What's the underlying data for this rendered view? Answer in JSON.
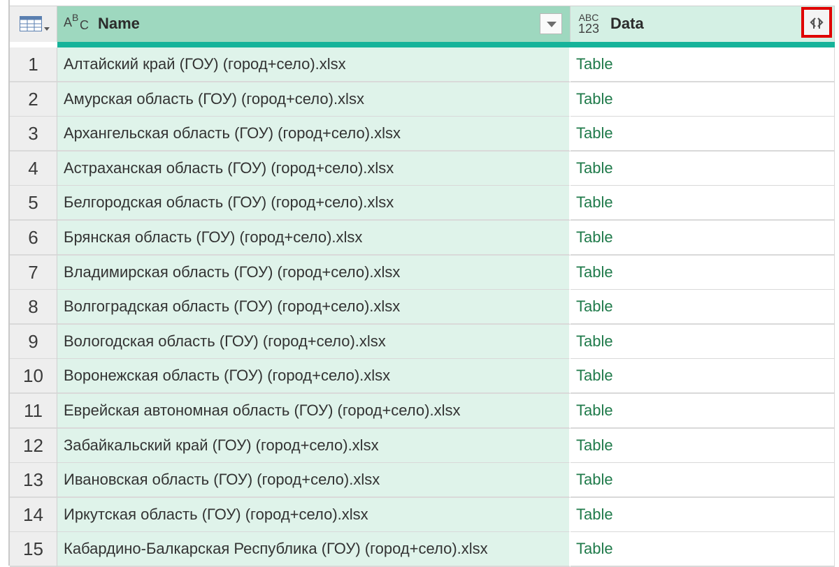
{
  "header": {
    "name_type_icon": "text-type-icon",
    "name_type_letters": [
      "A",
      "B",
      "C"
    ],
    "name_label": "Name",
    "data_type_icon": "any-type-icon",
    "data_type_top": "ABC",
    "data_type_bottom": "123",
    "data_label": "Data",
    "expand_icon": "expand-column-icon",
    "table_menu_icon": "table-icon"
  },
  "colors": {
    "header_name_bg": "#9ed8bf",
    "header_data_bg": "#d4f0e4",
    "accent_underline": "#16b39a",
    "name_cell_bg": "#dff3ea",
    "table_link": "#1f7a4a",
    "highlight_border": "#e00000"
  },
  "rows": [
    {
      "num": "1",
      "name": "Алтайский край (ГОУ) (город+село).xlsx",
      "data": "Table"
    },
    {
      "num": "2",
      "name": "Амурская область (ГОУ) (город+село).xlsx",
      "data": "Table"
    },
    {
      "num": "3",
      "name": "Архангельская область (ГОУ) (город+село).xlsx",
      "data": "Table"
    },
    {
      "num": "4",
      "name": "Астраханская область (ГОУ) (город+село).xlsx",
      "data": "Table"
    },
    {
      "num": "5",
      "name": "Белгородская область (ГОУ) (город+село).xlsx",
      "data": "Table"
    },
    {
      "num": "6",
      "name": "Брянская область (ГОУ) (город+село).xlsx",
      "data": "Table"
    },
    {
      "num": "7",
      "name": "Владимирская область (ГОУ) (город+село).xlsx",
      "data": "Table"
    },
    {
      "num": "8",
      "name": "Волгоградская область (ГОУ) (город+село).xlsx",
      "data": "Table"
    },
    {
      "num": "9",
      "name": "Вологодская область (ГОУ) (город+село).xlsx",
      "data": "Table"
    },
    {
      "num": "10",
      "name": "Воронежская область (ГОУ) (город+село).xlsx",
      "data": "Table"
    },
    {
      "num": "11",
      "name": "Еврейская автономная область (ГОУ) (город+село).xlsx",
      "data": "Table"
    },
    {
      "num": "12",
      "name": "Забайкальский край (ГОУ) (город+село).xlsx",
      "data": "Table"
    },
    {
      "num": "13",
      "name": "Ивановская область (ГОУ) (город+село).xlsx",
      "data": "Table"
    },
    {
      "num": "14",
      "name": "Иркутская область (ГОУ) (город+село).xlsx",
      "data": "Table"
    },
    {
      "num": "15",
      "name": "Кабардино-Балкарская Республика (ГОУ) (город+село).xlsx",
      "data": "Table"
    }
  ]
}
